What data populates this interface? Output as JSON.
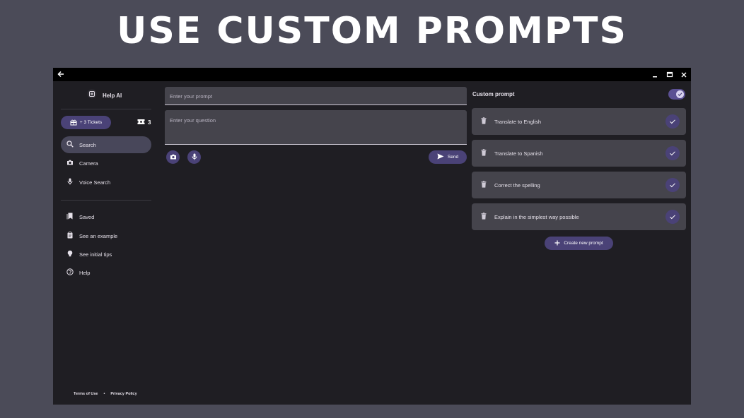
{
  "banner": {
    "title": "USE CUSTOM PROMPTS"
  },
  "titlebar": {
    "back_icon": "arrow-left-icon",
    "minimize_icon": "minimize-icon",
    "maximize_icon": "maximize-icon",
    "close_icon": "close-icon"
  },
  "sidebar": {
    "app_name": "Help AI",
    "tickets_button": "+ 3 Tickets",
    "ticket_count": "3",
    "nav_primary": [
      {
        "label": "Search",
        "icon": "search-icon",
        "active": true
      },
      {
        "label": "Camera",
        "icon": "camera-icon"
      },
      {
        "label": "Voice Search",
        "icon": "mic-icon"
      }
    ],
    "nav_secondary": [
      {
        "label": "Saved",
        "icon": "bookmark-icon"
      },
      {
        "label": "See an example",
        "icon": "clipboard-icon"
      },
      {
        "label": "See initial tips",
        "icon": "lightbulb-icon"
      },
      {
        "label": "Help",
        "icon": "help-icon"
      }
    ],
    "footer": {
      "terms": "Terms of Use",
      "separator": "•",
      "privacy": "Privacy Policy"
    }
  },
  "main": {
    "prompt_placeholder": "Enter your prompt",
    "question_placeholder": "Enter your question",
    "send_label": "Send"
  },
  "custom_prompt": {
    "title": "Custom prompt",
    "enabled": true,
    "prompts": [
      {
        "label": "Translate to English"
      },
      {
        "label": "Translate to Spanish"
      },
      {
        "label": "Correct the spelling"
      },
      {
        "label": "Explain in the simplest way possible"
      }
    ],
    "create_label": "Create new prompt"
  },
  "colors": {
    "accent": "#4a4277",
    "background": "#1f1e23",
    "surface": "#45444c",
    "page": "#4b4b58"
  }
}
